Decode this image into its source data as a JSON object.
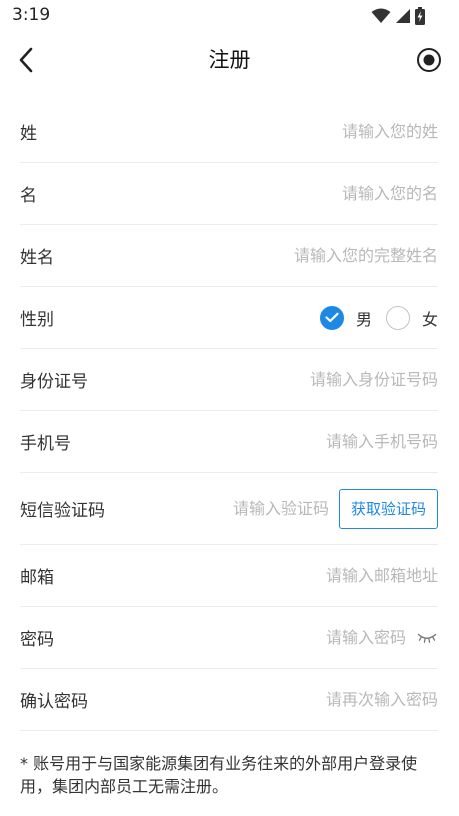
{
  "status": {
    "time": "3:19"
  },
  "header": {
    "title": "注册"
  },
  "form": {
    "surname": {
      "label": "姓",
      "placeholder": "请输入您的姓",
      "value": ""
    },
    "given_name": {
      "label": "名",
      "placeholder": "请输入您的名",
      "value": ""
    },
    "full_name": {
      "label": "姓名",
      "placeholder": "请输入您的完整姓名",
      "value": ""
    },
    "gender": {
      "label": "性别",
      "options": [
        "男",
        "女"
      ],
      "selected": "男"
    },
    "id_number": {
      "label": "身份证号",
      "placeholder": "请输入身份证号码",
      "value": ""
    },
    "phone": {
      "label": "手机号",
      "placeholder": "请输入手机号码",
      "value": ""
    },
    "sms_code": {
      "label": "短信验证码",
      "placeholder": "请输入验证码",
      "value": "",
      "button_label": "获取验证码"
    },
    "email": {
      "label": "邮箱",
      "placeholder": "请输入邮箱地址",
      "value": ""
    },
    "password": {
      "label": "密码",
      "placeholder": "请输入密码",
      "value": ""
    },
    "confirm_password": {
      "label": "确认密码",
      "placeholder": "请再次输入密码",
      "value": ""
    }
  },
  "note": "* 账号用于与国家能源集团有业务往来的外部用户登录使用，集团内部员工无需注册。",
  "colors": {
    "accent": "#1e88e5",
    "placeholder": "#b8b8b8",
    "divider": "#ececec"
  },
  "icons": {
    "back": "chevron-left-icon",
    "record": "record-icon",
    "password_toggle": "eye-closed-icon",
    "wifi": "wifi-icon",
    "signal": "signal-icon",
    "battery": "battery-charging-icon"
  }
}
